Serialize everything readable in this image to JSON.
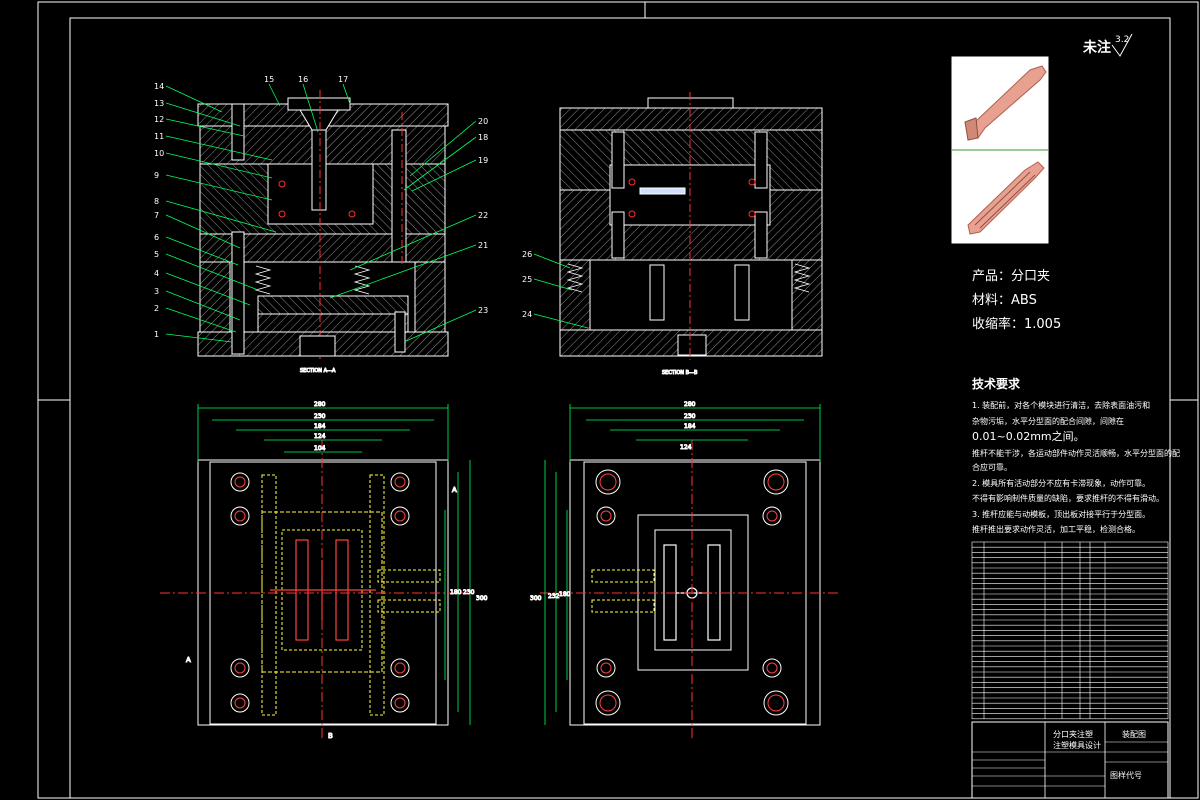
{
  "annotation": {
    "label": "未注",
    "roughness": "3.2"
  },
  "product": {
    "name_line": "产品：分口夹",
    "material_line": "材料：ABS",
    "shrink_line": "收缩率：1.005"
  },
  "tech": {
    "title": "技术要求",
    "lines": [
      "1. 装配前，对各个模块进行清洁，去除表面油污和",
      "杂物污垢，水平分型面的配合间隙，间隙在",
      "0.01~0.02mm之间。",
      "推杆不能干涉，各运动部件动作灵活顺畅，水平分型面的配",
      "合应可靠。",
      "2. 模具所有活动部分不应有卡滞现象，动作可靠。",
      "不得有影响制件质量的缺陷，要求推杆的不得有滑动。",
      "3. 推杆应能与动模板，顶出板对接平行于分型面。",
      "推杆推出要求动作灵活，加工平稳，检测合格。"
    ]
  },
  "sections": {
    "aa": "SECTION A—A",
    "bb": "SECTION B—B"
  },
  "part_numbers": [
    "1",
    "2",
    "3",
    "4",
    "5",
    "6",
    "7",
    "8",
    "9",
    "10",
    "11",
    "12",
    "13",
    "14",
    "15",
    "16",
    "17",
    "18",
    "19",
    "20",
    "21",
    "22",
    "23",
    "24",
    "25",
    "26"
  ],
  "plan_dims": {
    "left": {
      "overall_w": "280",
      "w2": "230",
      "w3": "184",
      "w4": "124",
      "w5": "104",
      "h1": "230",
      "h2": "300",
      "h3": "180"
    },
    "right": {
      "overall_w": "280",
      "w2": "230",
      "w3": "184",
      "w4": "124",
      "h1": "300",
      "h2": "232",
      "h3": "180"
    },
    "section_mark_a": "A",
    "section_mark_b": "B"
  },
  "title_block": {
    "name_line1": "分口夹注塑",
    "name_line2": "注塑模具设计",
    "drawing_type": "装配图",
    "scale_label": "图样代号"
  },
  "chart_data": null
}
